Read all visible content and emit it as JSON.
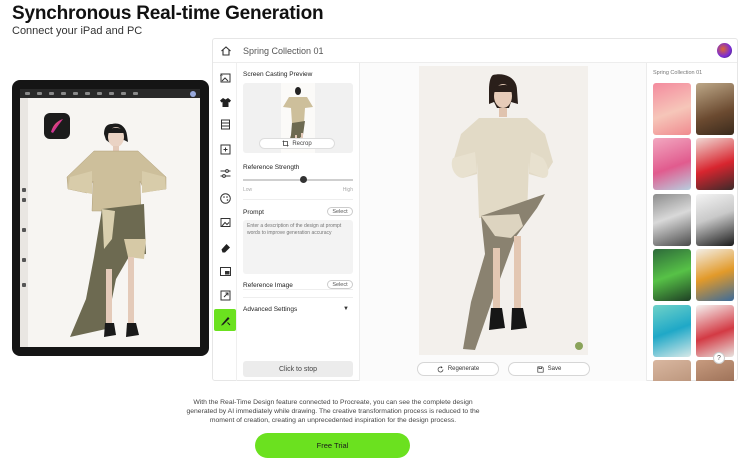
{
  "hero": {
    "title": "Synchronous Real-time Generation",
    "subtitle": "Connect your iPad and PC"
  },
  "app": {
    "title": "Spring Collection 01"
  },
  "panel": {
    "preview_label": "Screen Casting Preview",
    "recrop_label": "Recrop",
    "strength_label": "Reference Strength",
    "strength_low": "Low",
    "strength_high": "High",
    "strength_value": 0.55,
    "prompt_label": "Prompt",
    "prompt_select": "Select",
    "prompt_placeholder": "Enter a description of the design at prompt words to improve generation accuracy",
    "reference_label": "Reference Image",
    "reference_select": "Select",
    "advanced_label": "Advanced Settings",
    "advanced_caret": "▼",
    "stop_label": "Click to stop"
  },
  "canvas": {
    "regenerate_label": "Regenerate",
    "save_label": "Save"
  },
  "gallery": {
    "title": "Spring Collection 01",
    "help_label": "?"
  },
  "tools": [
    "home-icon",
    "text-image-icon",
    "shirt-icon",
    "fabric-icon",
    "crop-icon",
    "sliders-icon",
    "palette-icon",
    "image-icon",
    "eraser-icon",
    "picture-in-picture-icon",
    "expand-icon",
    "live-brush-icon"
  ],
  "colors": {
    "accent": "#6be11f"
  },
  "description": "With the Real-Time Design feature connected to Procreate, you can see the complete design generated by AI immediately while drawing. The creative transformation process is reduced to the moment of creation, creating an unprecedented inspiration for the design process.",
  "cta": {
    "label": "Free Trial"
  }
}
